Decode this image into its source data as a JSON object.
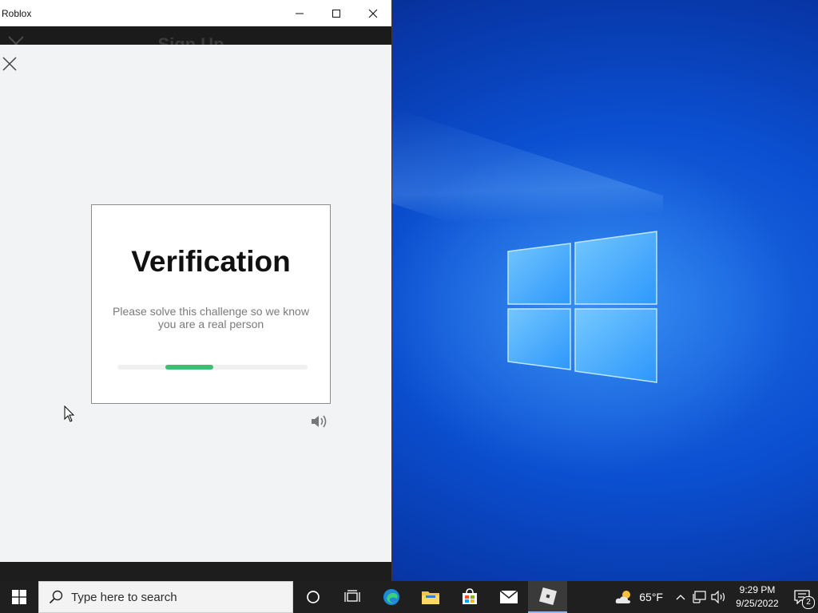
{
  "window": {
    "title": "Roblox",
    "behind_title": "Sign Up"
  },
  "verification": {
    "title": "Verification",
    "subtitle": "Please solve this challenge so we know you are a real person",
    "progress_fraction_start": 0.25,
    "progress_fraction_end": 0.5,
    "accent_color": "#3ebd75"
  },
  "taskbar": {
    "search_placeholder": "Type here to search",
    "apps": [
      "cortana-icon",
      "task-view-icon",
      "edge-icon",
      "file-explorer-icon",
      "store-icon",
      "mail-icon",
      "roblox-icon"
    ],
    "active_app": "roblox-icon",
    "weather_temp": "65°F",
    "time": "9:29 PM",
    "date": "9/25/2022",
    "notification_count": "2"
  }
}
